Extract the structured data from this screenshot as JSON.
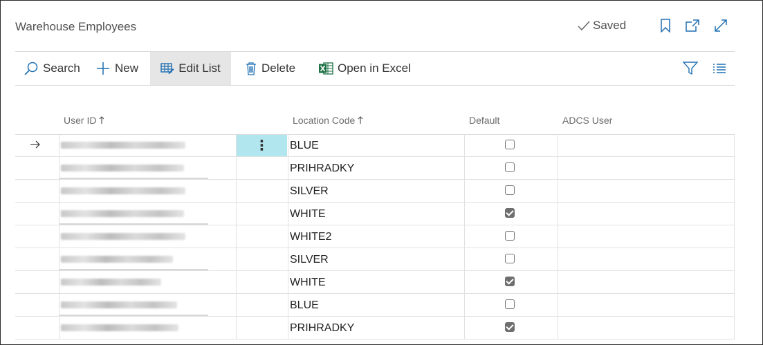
{
  "page": {
    "title": "Warehouse Employees",
    "status": "Saved",
    "icons": [
      "bookmark-icon",
      "open-new-window-icon",
      "expand-icon"
    ]
  },
  "toolbar": {
    "search": "Search",
    "new": "New",
    "edit_list": "Edit List",
    "delete": "Delete",
    "open_in_excel": "Open in Excel",
    "icons": [
      "search-icon",
      "plus-icon",
      "edit-grid-icon",
      "trash-icon",
      "excel-icon",
      "filter-icon",
      "list-view-icon"
    ]
  },
  "columns": {
    "user_id": "User ID",
    "location_code": "Location Code",
    "default": "Default",
    "adcs_user": "ADCS User"
  },
  "rows": [
    {
      "location": "BLUE",
      "default": false
    },
    {
      "location": "PRIHRADKY",
      "default": false
    },
    {
      "location": "SILVER",
      "default": false
    },
    {
      "location": "WHITE",
      "default": true
    },
    {
      "location": "WHITE2",
      "default": false
    },
    {
      "location": "SILVER",
      "default": false
    },
    {
      "location": "WHITE",
      "default": true
    },
    {
      "location": "BLUE",
      "default": false
    },
    {
      "location": "PRIHRADKY",
      "default": true
    }
  ],
  "colors": {
    "selected_cell": "#b2e6ee",
    "toolbar_active": "#e6e6e6",
    "excel_green": "#1e7145",
    "accent_blue": "#1f6fb2"
  }
}
